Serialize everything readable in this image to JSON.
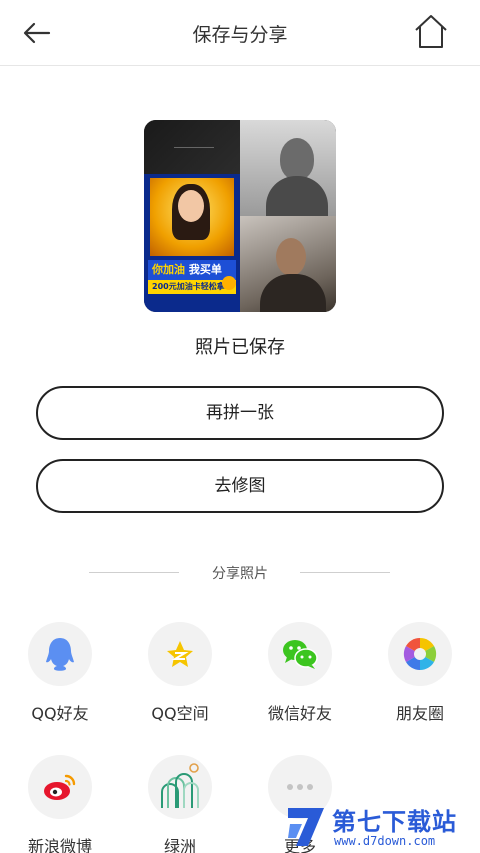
{
  "header": {
    "title": "保存与分享",
    "back_icon": "arrow-left-icon",
    "home_icon": "home-icon"
  },
  "collage": {
    "banner_text_a": "你",
    "banner_text_b": "加油",
    "banner_text_c": " 我买单",
    "banner_sub": "200元加油卡轻松拿"
  },
  "status": {
    "saved_text": "照片已保存"
  },
  "actions": {
    "redo_label": "再拼一张",
    "edit_label": "去修图"
  },
  "share": {
    "title": "分享照片",
    "items": [
      {
        "label": "QQ好友",
        "icon": "qq-icon"
      },
      {
        "label": "QQ空间",
        "icon": "qzone-icon"
      },
      {
        "label": "微信好友",
        "icon": "wechat-icon"
      },
      {
        "label": "朋友圈",
        "icon": "moments-icon"
      },
      {
        "label": "新浪微博",
        "icon": "weibo-icon"
      },
      {
        "label": "绿洲",
        "icon": "oasis-icon"
      },
      {
        "label": "更多",
        "icon": "more-icon"
      }
    ]
  },
  "watermark": {
    "name": "第七下载站",
    "url": "www.d7down.com"
  },
  "colors": {
    "qq_blue": "#5b8ff2",
    "qzone_yellow": "#f6c500",
    "wechat_green": "#3cc51f",
    "weibo_red": "#e6162d",
    "oasis_green": "#2a9a76",
    "watermark_blue": "#2a5bd7"
  }
}
